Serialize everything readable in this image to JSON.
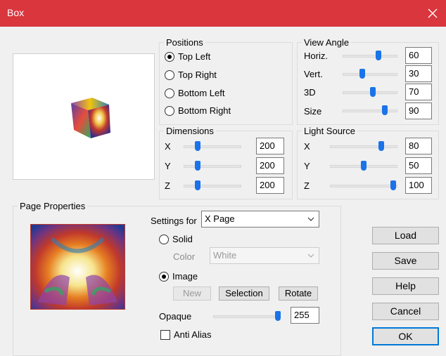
{
  "window": {
    "title": "Box"
  },
  "positions": {
    "title": "Positions",
    "options": [
      "Top Left",
      "Top Right",
      "Bottom Left",
      "Bottom Right"
    ],
    "selected": "Top Left"
  },
  "view_angle": {
    "title": "View Angle",
    "rows": [
      {
        "label": "Horiz.",
        "value": "60",
        "level": 0.6
      },
      {
        "label": "Vert.",
        "value": "30",
        "level": 0.3
      },
      {
        "label": "3D",
        "value": "70",
        "level": 0.5
      },
      {
        "label": "Size",
        "value": "90",
        "level": 0.8
      }
    ]
  },
  "dimensions": {
    "title": "Dimensions",
    "rows": [
      {
        "label": "X",
        "value": "200",
        "level": 0.2
      },
      {
        "label": "Y",
        "value": "200",
        "level": 0.2
      },
      {
        "label": "Z",
        "value": "200",
        "level": 0.2
      }
    ]
  },
  "light_source": {
    "title": "Light Source",
    "rows": [
      {
        "label": "X",
        "value": "80",
        "level": 0.8
      },
      {
        "label": "Y",
        "value": "50",
        "level": 0.5
      },
      {
        "label": "Z",
        "value": "100",
        "level": 1.0
      }
    ]
  },
  "page_properties": {
    "title": "Page Properties",
    "settings_for_label": "Settings for",
    "settings_for_value": "X Page",
    "solid_label": "Solid",
    "color_label": "Color",
    "color_value": "White",
    "image_label": "Image",
    "fill_mode": "Image",
    "new_label": "New",
    "selection_label": "Selection",
    "rotate_label": "Rotate",
    "opaque_label": "Opaque",
    "opaque_value": "255",
    "opaque_level": 1.0,
    "anti_alias_label": "Anti Alias",
    "anti_alias_checked": false
  },
  "buttons": {
    "load": "Load",
    "save": "Save",
    "help": "Help",
    "cancel": "Cancel",
    "ok": "OK"
  }
}
